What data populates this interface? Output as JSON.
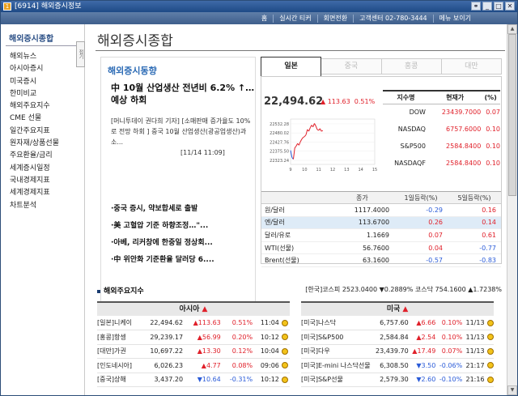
{
  "window": {
    "app_code": "[6914]",
    "title": "해외증시정보"
  },
  "topnav": {
    "items": [
      "홈",
      "실시간 티커",
      "회면전환",
      "고객센터 02-780-3444",
      "메뉴 보이기"
    ]
  },
  "sidebar": {
    "heading": "해외증시종합",
    "tab_label": "접기",
    "items": [
      "해외뉴스",
      "아시아증시",
      "미국증시",
      "한미비교",
      "해외주요지수",
      "CME 선물",
      "일간주요지표",
      "원자재/상품선물",
      "주요환율/금리",
      "세계증시일정",
      "국내경제지표",
      "세계경제지표",
      "차트분석"
    ]
  },
  "page": {
    "title": "해외증시종합"
  },
  "news": {
    "heading": "해외증시동향",
    "headline": "中 10월 산업생산 전년비 6.2% ↑…예상 하회",
    "summary": "[머니투데이 권다희 기자] [소매판매 증가율도 10%로 전망 하회 ] 중국 10월 산업생산(광공업생산)과 소...",
    "date": "[11/14 11:09]",
    "links": [
      "·중국 증시, 약보합세로 출발",
      "·美 고혈압 기준 하향조정…\"...",
      "·아베, 리커창에 한중일 정상회...",
      "·中 위안화 기준환율 달러당 6...."
    ]
  },
  "tabs": [
    {
      "label": "일본",
      "active": true
    },
    {
      "label": "중국"
    },
    {
      "label": "홍콩"
    },
    {
      "label": "대만"
    }
  ],
  "quote": {
    "value": "22,494.62",
    "change": "▲ 113.63",
    "pct": "0.51%"
  },
  "chart_data": {
    "type": "line",
    "x_ticks": [
      "9",
      "10",
      "11",
      "12",
      "13",
      "14",
      "15"
    ],
    "y_ticks": [
      "22532.28",
      "22480.02",
      "22427.76",
      "22375.50",
      "22323.24"
    ],
    "ylim": [
      22300,
      22560
    ],
    "x": [
      9.0,
      9.1,
      9.2,
      9.3,
      9.4,
      9.5,
      9.6,
      9.7,
      9.8,
      9.9,
      10.0,
      10.1,
      10.2,
      10.3,
      10.4,
      10.5,
      10.6,
      10.7,
      10.8,
      10.9,
      11.0,
      11.1,
      11.2,
      11.3
    ],
    "values": [
      22380,
      22340,
      22330,
      22395,
      22405,
      22420,
      22410,
      22430,
      22445,
      22455,
      22460,
      22470,
      22500,
      22490,
      22510,
      22525,
      22515,
      22535,
      22520,
      22500,
      22495,
      22505,
      22490,
      22494
    ]
  },
  "indices": {
    "headers": [
      "지수명",
      "현재가",
      "(%)"
    ],
    "rows": [
      [
        "DOW",
        "23439.7000",
        "0.07"
      ],
      [
        "NASDAQ",
        "6757.6000",
        "0.10"
      ],
      [
        "S&P500",
        "2584.8400",
        "0.10"
      ],
      [
        "NASDAQF",
        "2584.8400",
        "0.10"
      ]
    ]
  },
  "fx": {
    "headers": [
      "",
      "종가",
      "1일등락(%)",
      "5일등락(%)"
    ],
    "rows": [
      [
        "원/달러",
        "1117.4000",
        "-0.29",
        "0.16"
      ],
      [
        "엔/달러",
        "113.6700",
        "0.26",
        "0.14"
      ],
      [
        "달러/유로",
        "1.1669",
        "0.07",
        "0.61"
      ],
      [
        "WTI(선물)",
        "56.7600",
        "0.04",
        "-0.77"
      ],
      [
        "Brent(선물)",
        "63.1600",
        "-0.57",
        "-0.83"
      ]
    ],
    "highlight_row": 1
  },
  "major": {
    "heading": "해외주요지수",
    "kospi": "[한국]코스피 2523.0400 ▼0.2889%  코스닥 754.1600 ▲1.7238%"
  },
  "asia": {
    "heading": "아시아",
    "rows": [
      [
        "[일본]니케이",
        "22,494.62",
        "▲113.63",
        "0.51%",
        "11:04"
      ],
      [
        "[홍콩]항셍",
        "29,239.17",
        "▲56.99",
        "0.20%",
        "10:12"
      ],
      [
        "[대만]가권",
        "10,697.22",
        "▲13.30",
        "0.12%",
        "10:04"
      ],
      [
        "[인도네시아]",
        "6,026.23",
        "▲4.77",
        "0.08%",
        "09:06"
      ],
      [
        "[중국]상해",
        "3,437.20",
        "▼10.64",
        "-0.31%",
        "10:12"
      ]
    ]
  },
  "usa": {
    "heading": "미국",
    "rows": [
      [
        "[미국]나스닥",
        "6,757.60",
        "▲6.66",
        "0.10%",
        "11/13"
      ],
      [
        "[미국]S&P500",
        "2,584.84",
        "▲2.54",
        "0.10%",
        "11/13"
      ],
      [
        "[미국]다우",
        "23,439.70",
        "▲17.49",
        "0.07%",
        "11/13"
      ],
      [
        "[미국]E-mini 나스닥선물",
        "6,308.50",
        "▼3.50",
        "-0.06%",
        "21:17"
      ],
      [
        "[미국]S&P선물",
        "2,579.30",
        "▼2.60",
        "-0.10%",
        "21:16"
      ]
    ]
  }
}
